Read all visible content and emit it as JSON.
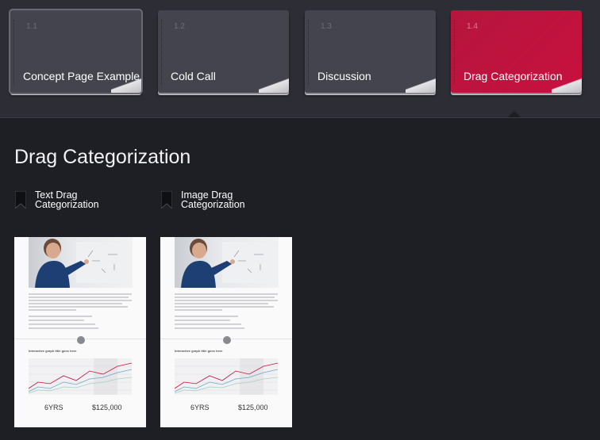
{
  "lessons": [
    {
      "number": "1.1",
      "title": "Concept Page Example",
      "state": "active"
    },
    {
      "number": "1.2",
      "title": "Cold Call",
      "state": "normal"
    },
    {
      "number": "1.3",
      "title": "Discussion",
      "state": "normal"
    },
    {
      "number": "1.4",
      "title": "Drag Categorization",
      "state": "selected"
    }
  ],
  "section": {
    "title": "Drag Categorization",
    "items": [
      {
        "label": "Text Drag Categorization",
        "icon": "bookmark-icon"
      },
      {
        "label": "Image Drag Categorization",
        "icon": "bookmark-icon"
      }
    ]
  },
  "thumbnails": [
    {
      "graph_title": "Interactive graph title goes here",
      "stat_left": "6YRS",
      "stat_right": "$125,000"
    },
    {
      "graph_title": "Interactive graph title goes here",
      "stat_left": "6YRS",
      "stat_right": "$125,000"
    }
  ],
  "colors": {
    "background": "#1e1f24",
    "card": "#43444d",
    "accent": "#c8103f"
  }
}
